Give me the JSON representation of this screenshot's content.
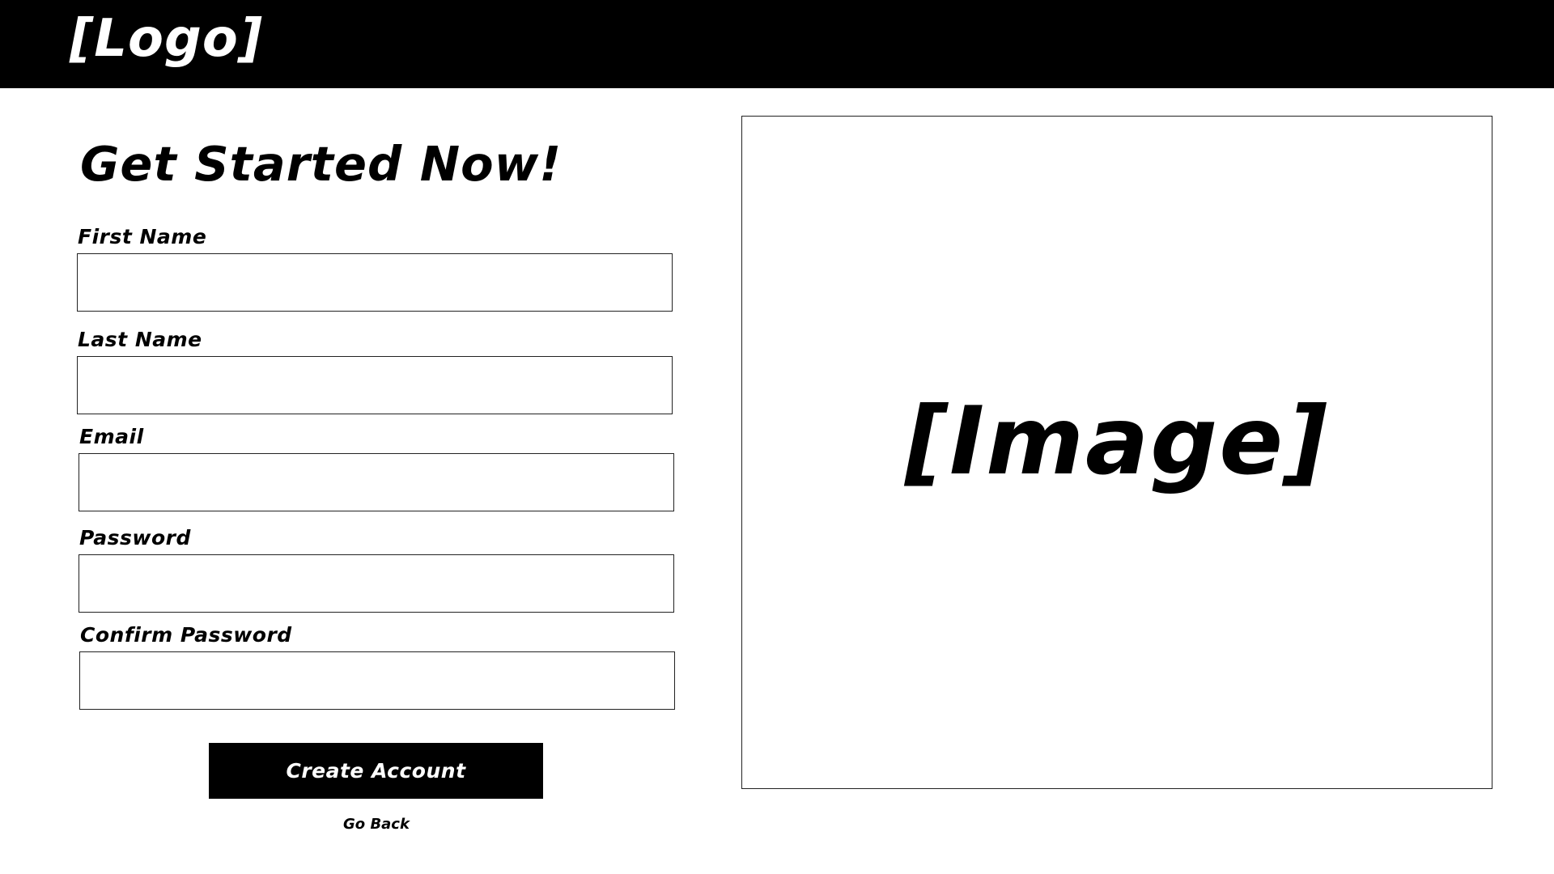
{
  "header": {
    "logo_text": "[Logo]"
  },
  "form": {
    "title": "Get Started Now!",
    "fields": [
      {
        "label": "First Name",
        "value": "",
        "placeholder": ""
      },
      {
        "label": "Last Name",
        "value": "",
        "placeholder": ""
      },
      {
        "label": "Email",
        "value": "",
        "placeholder": ""
      },
      {
        "label": "Password",
        "value": "",
        "placeholder": ""
      },
      {
        "label": "Confirm Password",
        "value": "",
        "placeholder": ""
      }
    ],
    "submit_label": "Create Account",
    "back_label": "Go Back"
  },
  "hero": {
    "placeholder_text": "[Image]"
  },
  "colors": {
    "header_bg": "#000000",
    "button_bg": "#000000",
    "page_bg": "#ffffff"
  }
}
